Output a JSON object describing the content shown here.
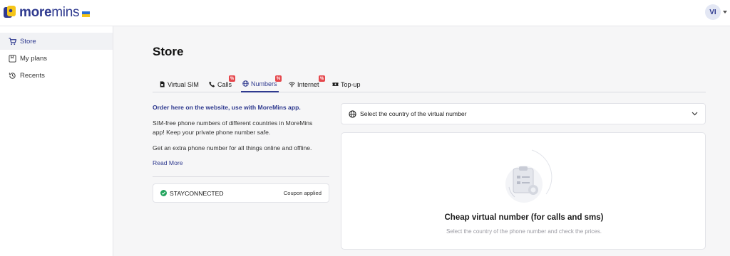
{
  "header": {
    "brand_bold": "more",
    "brand_light": "mins",
    "avatar_initials": "VI"
  },
  "sidebar": {
    "items": [
      {
        "label": "Store",
        "icon": "cart-icon",
        "active": true
      },
      {
        "label": "My plans",
        "icon": "plans-icon",
        "active": false
      },
      {
        "label": "Recents",
        "icon": "history-icon",
        "active": false
      }
    ]
  },
  "main": {
    "title": "Store",
    "tabs": [
      {
        "label": "Virtual SIM",
        "icon": "sim-icon",
        "badge": ""
      },
      {
        "label": "Calls",
        "icon": "phone-icon",
        "badge": "%"
      },
      {
        "label": "Numbers",
        "icon": "globe-icon",
        "badge": "%",
        "active": true
      },
      {
        "label": "Internet",
        "icon": "wifi-icon",
        "badge": "%"
      },
      {
        "label": "Top-up",
        "icon": "ticket-icon",
        "badge": ""
      }
    ],
    "order_link": "Order here on the website, use with MoreMins app.",
    "para1_line1": "SIM-free phone numbers of different countries in MoreMins",
    "para1_line2": "app! Keep your private phone number safe.",
    "para2": "Get an extra phone number for all things online and offline.",
    "read_more": "Read More",
    "coupon": {
      "code": "STAYCONNECTED",
      "status": "Coupon applied"
    },
    "country_select": {
      "placeholder": "Select the country of the virtual number"
    },
    "panel": {
      "title": "Cheap virtual number (for calls and sms)",
      "subtitle": "Select the country of the phone number and check the prices."
    }
  },
  "colors": {
    "accent": "#2f3a8f",
    "badge": "#e5484d",
    "success": "#22a45d"
  }
}
